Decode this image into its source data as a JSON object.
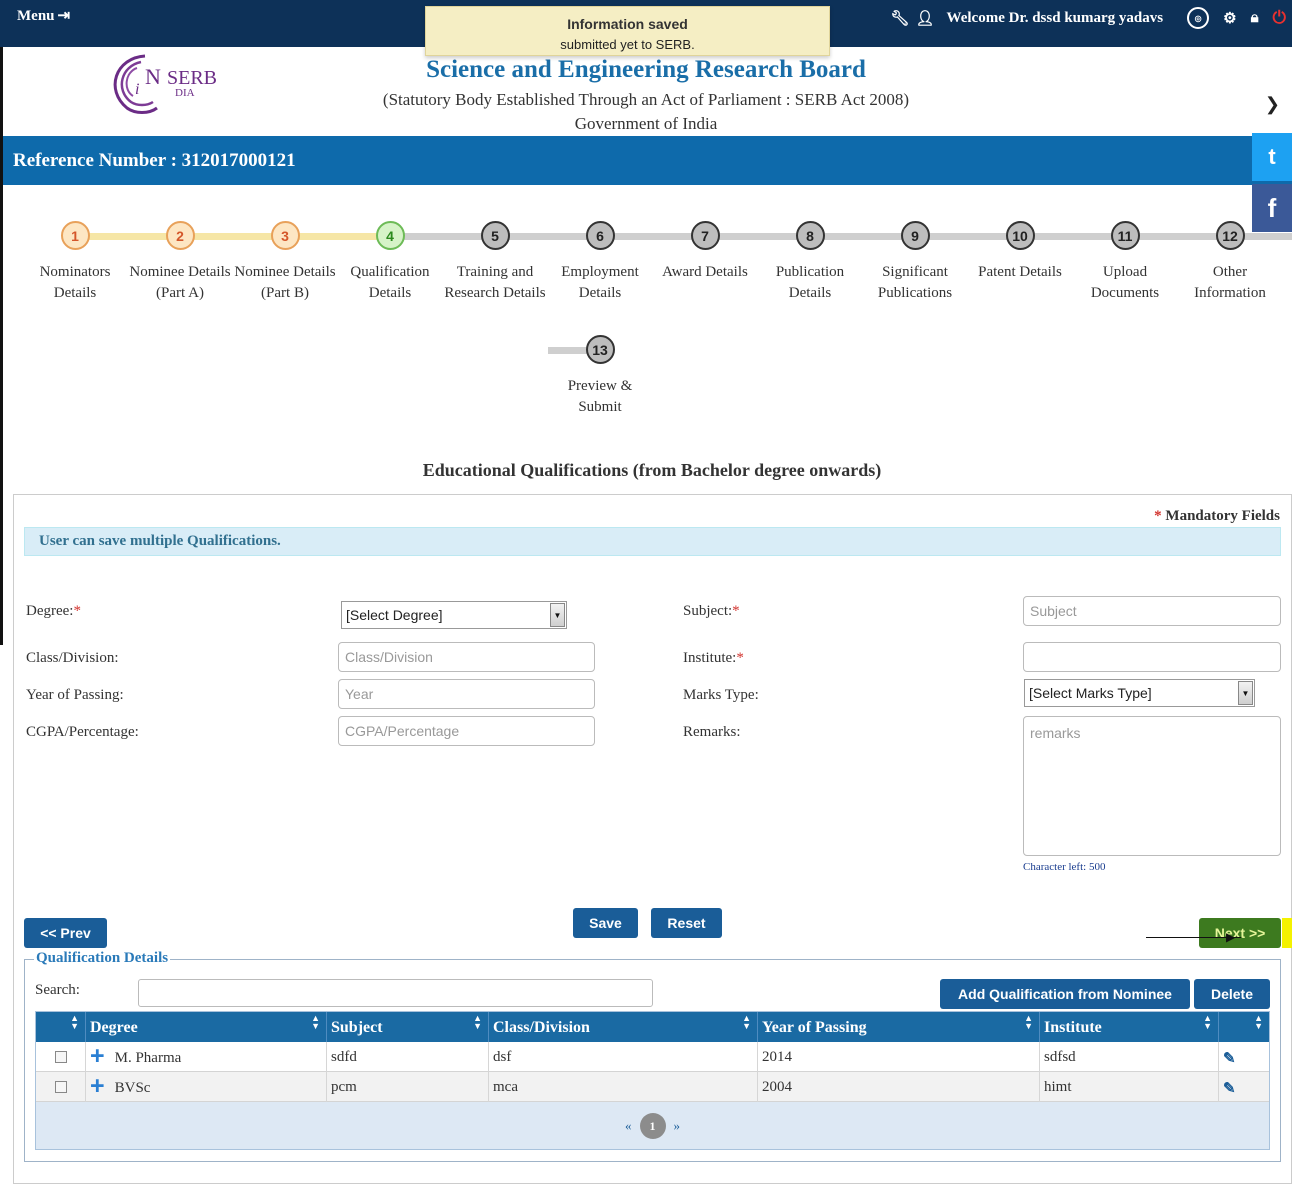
{
  "topbar": {
    "menu_label": "Menu",
    "menu_icon": "sign-in-icon",
    "welcome": "Welcome Dr. dssd kumarg yadavs",
    "toast_line1": "Information saved",
    "toast_line2": "submitted yet to SERB."
  },
  "header": {
    "logo_text": "SERB",
    "logo_sub": "DIA",
    "title": "Science and Engineering Research Board",
    "subtitle": "(Statutory Body Established Through an Act of Parliament : SERB Act 2008)",
    "gov": "Government of India",
    "reference": "Reference Number : 312017000121"
  },
  "social": {
    "twitter": "t",
    "facebook": "f"
  },
  "steps": [
    {
      "num": "1",
      "label": "Nominators Details",
      "state": "done"
    },
    {
      "num": "2",
      "label": "Nominee Details (Part A)",
      "state": "done"
    },
    {
      "num": "3",
      "label": "Nominee Details (Part B)",
      "state": "done"
    },
    {
      "num": "4",
      "label": "Qualification Details",
      "state": "current"
    },
    {
      "num": "5",
      "label": "Training and Research Details",
      "state": "todo"
    },
    {
      "num": "6",
      "label": "Employment Details",
      "state": "todo"
    },
    {
      "num": "7",
      "label": "Award Details",
      "state": "todo"
    },
    {
      "num": "8",
      "label": "Publication Details",
      "state": "todo"
    },
    {
      "num": "9",
      "label": "Significant Publications",
      "state": "todo"
    },
    {
      "num": "10",
      "label": "Patent Details",
      "state": "todo"
    },
    {
      "num": "11",
      "label": "Upload Documents",
      "state": "todo"
    },
    {
      "num": "12",
      "label": "Other Information",
      "state": "todo"
    },
    {
      "num": "13",
      "label": "Preview & Submit",
      "state": "todo"
    }
  ],
  "section": {
    "title": "Educational Qualifications (from Bachelor degree onwards)",
    "mandatory": "Mandatory Fields",
    "info": "User can save multiple Qualifications."
  },
  "form": {
    "degree_label": "Degree:",
    "degree_value": "[Select Degree]",
    "class_label": "Class/Division:",
    "class_placeholder": "Class/Division",
    "year_label": "Year of Passing:",
    "year_placeholder": "Year",
    "cgpa_label": "CGPA/Percentage:",
    "cgpa_placeholder": "CGPA/Percentage",
    "subject_label": "Subject:",
    "subject_placeholder": "Subject",
    "institute_label": "Institute:",
    "institute_value": "",
    "marks_label": "Marks Type:",
    "marks_value": "[Select Marks Type]",
    "remarks_label": "Remarks:",
    "remarks_placeholder": "remarks",
    "char_left": "Character left: 500"
  },
  "buttons": {
    "prev": "<< Prev",
    "save": "Save",
    "reset": "Reset",
    "next": "Next >>",
    "add_from_nominee": "Add Qualification from Nominee",
    "delete": "Delete"
  },
  "grid": {
    "legend": "Qualification Details",
    "search_label": "Search:",
    "columns": [
      "",
      "Degree",
      "Subject",
      "Class/Division",
      "Year of Passing",
      "Institute",
      ""
    ],
    "rows": [
      {
        "degree": "M. Pharma",
        "subject": "sdfd",
        "class": "dsf",
        "year": "2014",
        "institute": "sdfsd"
      },
      {
        "degree": "BVSc",
        "subject": "pcm",
        "class": "mca",
        "year": "2004",
        "institute": "himt"
      }
    ],
    "pager_prev": "«",
    "page": "1",
    "pager_next": "»"
  },
  "colors": {
    "topbar": "#0d3158",
    "refbar": "#0e6aab",
    "button": "#1a5d98",
    "title_blue": "#1a6ea8"
  }
}
